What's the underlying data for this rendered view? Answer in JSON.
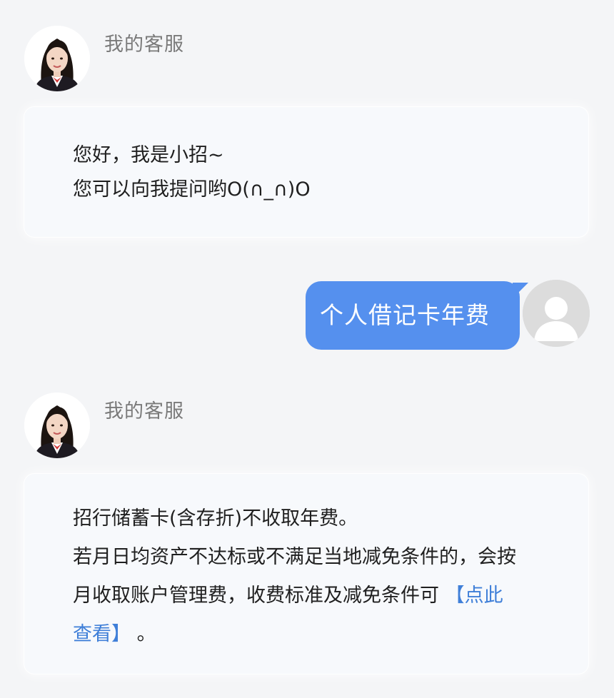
{
  "messages": [
    {
      "sender": "我的客服",
      "lines": [
        "您好，我是小招~",
        "您可以向我提问哟O(∩_∩)O"
      ]
    },
    {
      "user_text": "个人借记卡年费"
    },
    {
      "sender": "我的客服",
      "lines": [
        "招行储蓄卡(含存折)不收取年费。",
        "若月日均资产不达标或不满足当地减免条件的，会按",
        "月收取账户管理费，收费标准及减免条件可 "
      ],
      "link_part1": "【点此",
      "link_part2": "查看】",
      "tail": " 。"
    }
  ],
  "colors": {
    "user_bubble": "#5590ee",
    "link": "#3f7fd8",
    "sender_name": "#7a7a7a"
  },
  "icons": {
    "agent_avatar": "agent-photo",
    "user_avatar": "default-user-icon"
  }
}
